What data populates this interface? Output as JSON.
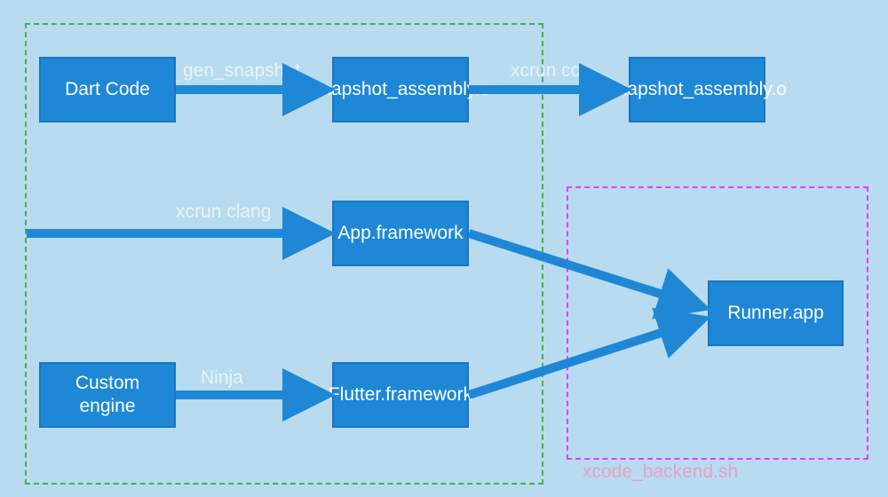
{
  "nodes": {
    "dart_code": "Dart Code",
    "snapshot_s": "snapshot_assembly.s",
    "snapshot_o": "snapshot_assembly.o",
    "app_framework": "App.framework",
    "custom_engine": "Custom engine",
    "flutter_framework": "Flutter.framework",
    "runner_app": "Runner.app"
  },
  "edges": {
    "gen_snapshot": "gen_snapshot",
    "xcrun_cc": "xcrun cc",
    "xcrun_clang": "xcrun clang",
    "ninja": "Ninja"
  },
  "regions": {
    "xcode_backend": "xcode_backend.sh"
  },
  "colors": {
    "background": "#b8dbf0",
    "node_fill": "#1e88d6",
    "node_border": "#1976c2",
    "green_dash": "#4caf50",
    "pink_dash": "#e040fb",
    "label_text": "#e8f4fb",
    "pink_label": "#e8a0c8"
  }
}
